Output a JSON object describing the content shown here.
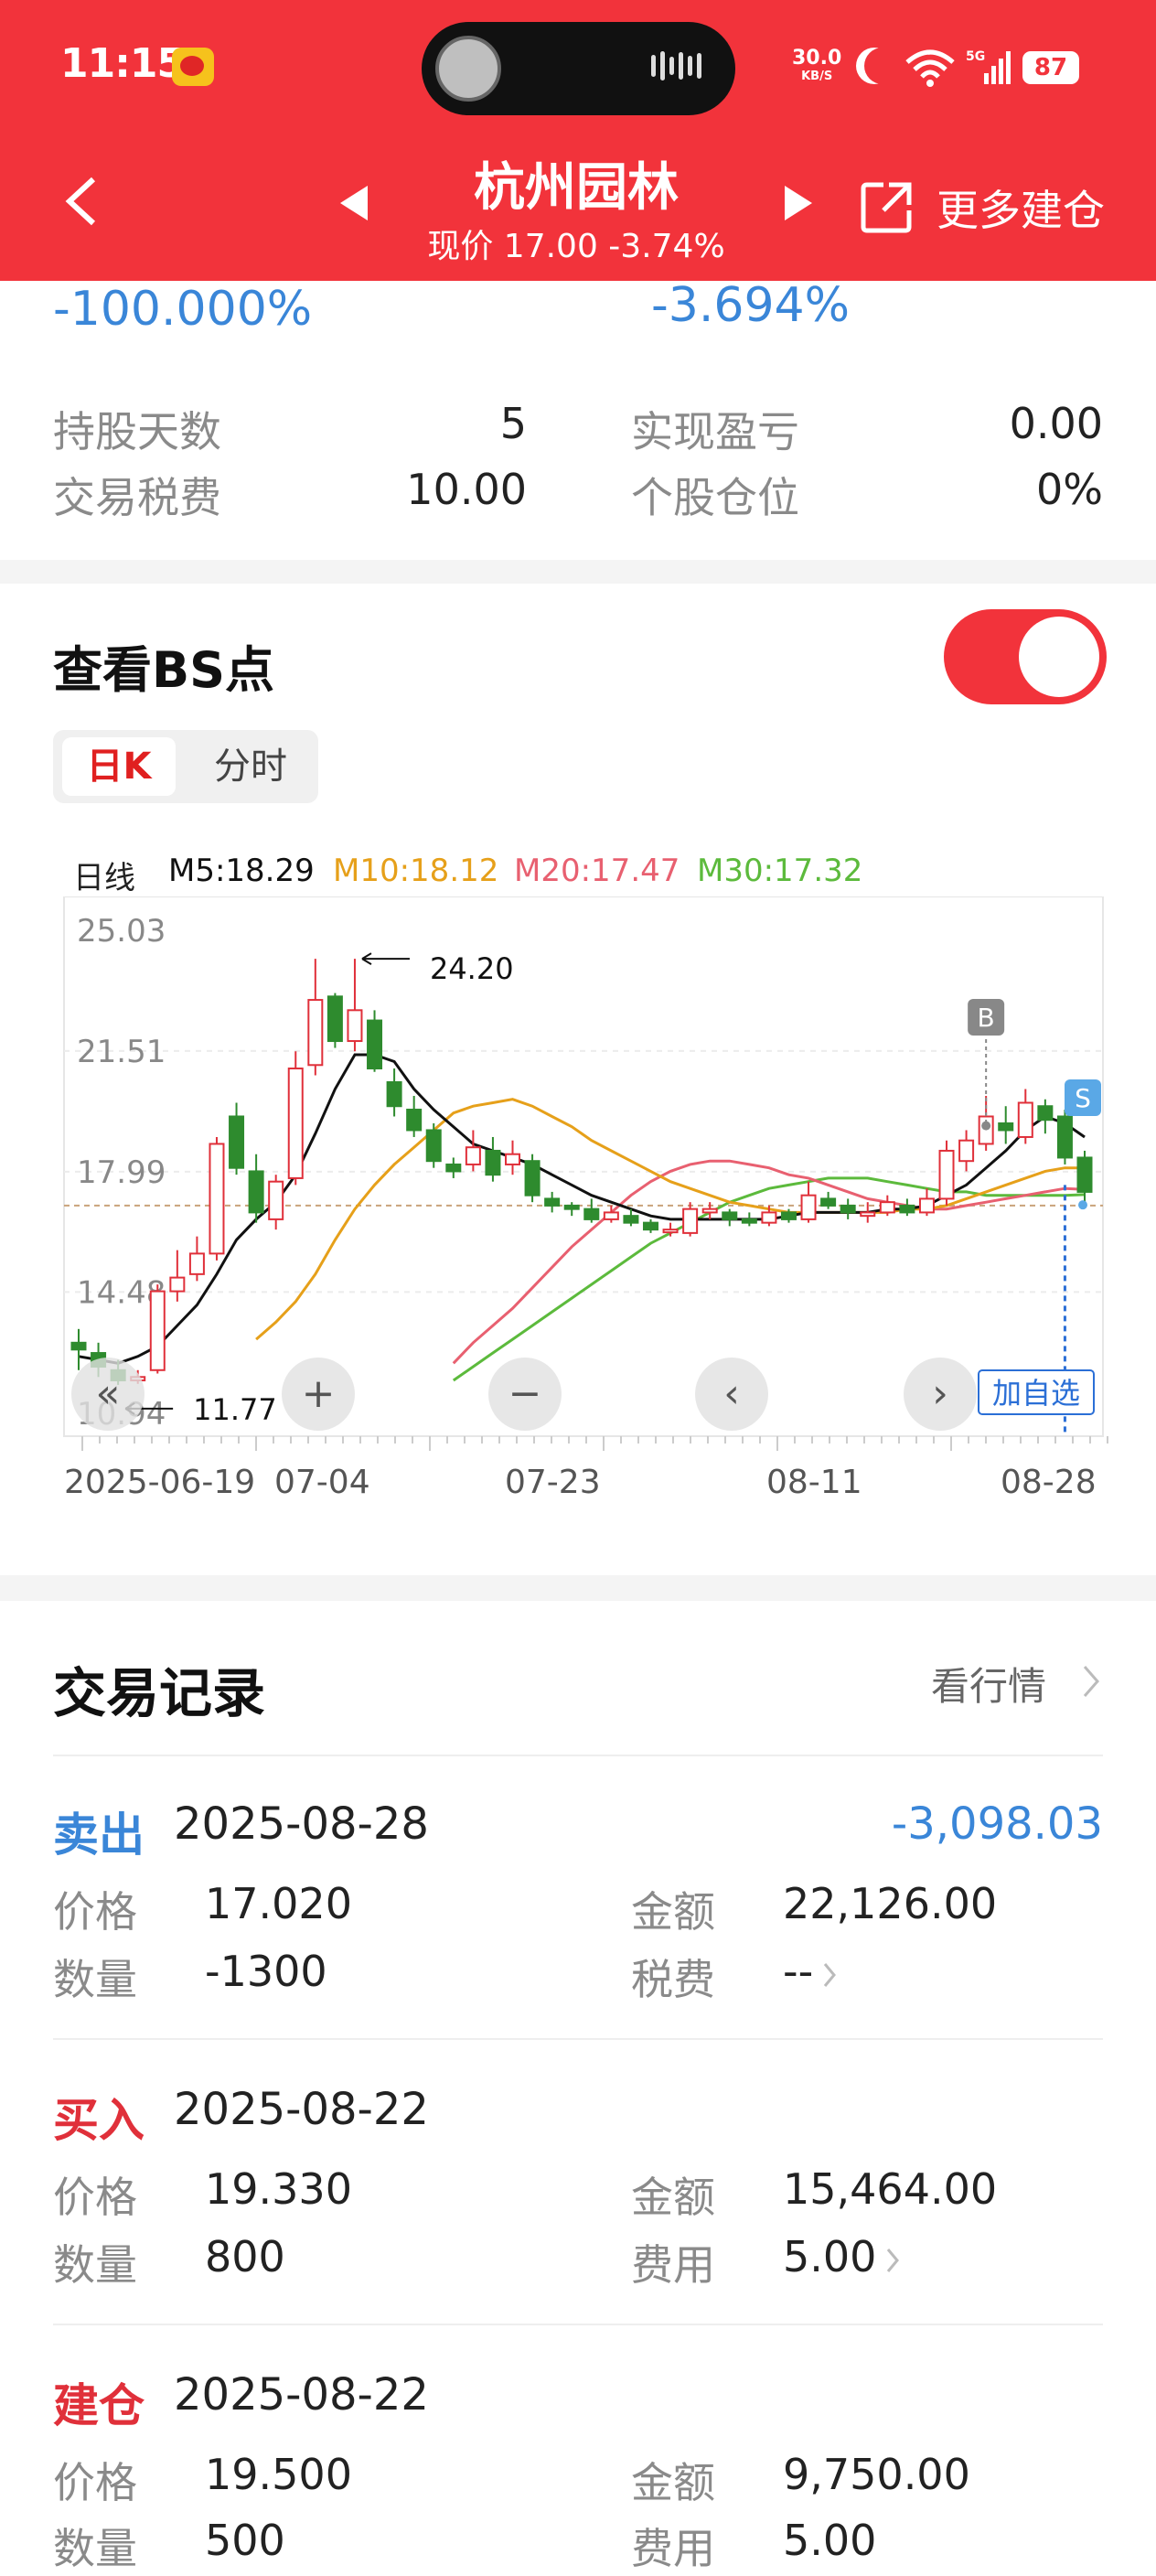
{
  "status_bar": {
    "time": "11:15",
    "net_speed": "30.0",
    "net_unit": "KB/S",
    "network": "5G",
    "battery": "87"
  },
  "header": {
    "stock_name": "杭州园林",
    "price_line": "现价 17.00 -3.74%",
    "more_label": "更多建仓"
  },
  "summary": {
    "pct_left": "-100.000%",
    "pct_right": "-3.694%",
    "hold_days_label": "持股天数",
    "hold_days_value": "5",
    "realized_pnl_label": "实现盈亏",
    "realized_pnl_value": "0.00",
    "tax_label": "交易税费",
    "tax_value": "10.00",
    "position_label": "个股仓位",
    "position_value": "0%"
  },
  "bs_section": {
    "title": "查看BS点",
    "toggle_on": true,
    "tab_daily": "日K",
    "tab_intraday": "分时"
  },
  "ma_legend": {
    "period": "日线",
    "m5": "M5:18.29",
    "m10": "M10:18.12",
    "m20": "M20:17.47",
    "m30": "M30:17.32"
  },
  "colors": {
    "accent": "#f2333b",
    "up": "#e0303a",
    "down": "#2e8b2e",
    "ma5": "#111111",
    "ma10": "#e6a01a",
    "ma20": "#e86070",
    "ma30": "#5cba3c",
    "blue": "#3a86d8"
  },
  "chart_controls": {
    "add_watch_label": "加自选",
    "buy_marker": "B",
    "sell_marker": "S"
  },
  "chart_data": {
    "type": "candlestick",
    "yticks": [
      "25.03",
      "21.51",
      "17.99",
      "14.48",
      "10.94"
    ],
    "ylim": [
      10.94,
      25.03
    ],
    "xticks": [
      "2025-06-19",
      "07-04",
      "07-23",
      "08-11",
      "08-28"
    ],
    "max_label": "24.20",
    "min_label": "11.77",
    "ref_price": 17.0,
    "candles": [
      [
        13.0,
        12.8,
        13.4,
        12.2
      ],
      [
        12.7,
        12.3,
        13.0,
        12.0
      ],
      [
        12.2,
        11.9,
        12.5,
        11.77
      ],
      [
        11.9,
        12.0,
        12.2,
        11.8
      ],
      [
        12.2,
        14.5,
        14.7,
        12.1
      ],
      [
        14.5,
        14.9,
        15.7,
        14.2
      ],
      [
        15.0,
        15.6,
        16.1,
        14.8
      ],
      [
        15.6,
        18.8,
        19.0,
        15.4
      ],
      [
        19.6,
        18.1,
        20.0,
        17.9
      ],
      [
        18.0,
        16.8,
        18.5,
        16.5
      ],
      [
        16.6,
        17.7,
        17.9,
        16.3
      ],
      [
        17.8,
        21.0,
        21.5,
        17.6
      ],
      [
        21.1,
        23.0,
        24.2,
        20.8
      ],
      [
        23.1,
        21.8,
        23.2,
        21.6
      ],
      [
        21.8,
        22.7,
        24.2,
        21.5
      ],
      [
        22.4,
        21.0,
        22.7,
        20.9
      ],
      [
        20.6,
        19.9,
        21.0,
        19.6
      ],
      [
        19.8,
        19.2,
        20.2,
        19.0
      ],
      [
        19.2,
        18.3,
        19.4,
        18.1
      ],
      [
        18.2,
        18.0,
        18.4,
        17.8
      ],
      [
        18.2,
        18.7,
        19.2,
        18.0
      ],
      [
        18.6,
        17.9,
        19.0,
        17.7
      ],
      [
        18.2,
        18.5,
        18.9,
        17.9
      ],
      [
        18.3,
        17.3,
        18.5,
        17.1
      ],
      [
        17.2,
        17.0,
        17.4,
        16.8
      ],
      [
        17.0,
        16.9,
        17.1,
        16.7
      ],
      [
        16.9,
        16.6,
        17.2,
        16.5
      ],
      [
        16.6,
        16.8,
        17.0,
        16.5
      ],
      [
        16.7,
        16.5,
        16.9,
        16.4
      ],
      [
        16.5,
        16.3,
        16.6,
        16.2
      ],
      [
        16.3,
        16.3,
        16.5,
        16.1
      ],
      [
        16.2,
        16.9,
        17.1,
        16.1
      ],
      [
        16.8,
        16.9,
        17.1,
        16.6
      ],
      [
        16.8,
        16.6,
        16.9,
        16.4
      ],
      [
        16.6,
        16.5,
        16.8,
        16.4
      ],
      [
        16.5,
        16.8,
        17.0,
        16.4
      ],
      [
        16.8,
        16.6,
        16.9,
        16.5
      ],
      [
        16.6,
        17.3,
        17.7,
        16.5
      ],
      [
        17.2,
        17.0,
        17.4,
        16.9
      ],
      [
        17.0,
        16.8,
        17.2,
        16.6
      ],
      [
        16.7,
        16.8,
        17.1,
        16.5
      ],
      [
        16.8,
        17.1,
        17.3,
        16.7
      ],
      [
        17.0,
        16.8,
        17.2,
        16.7
      ],
      [
        16.8,
        17.2,
        17.5,
        16.7
      ],
      [
        17.2,
        18.6,
        18.9,
        17.0
      ],
      [
        18.3,
        18.9,
        19.2,
        18.0
      ],
      [
        18.8,
        19.6,
        20.2,
        18.6
      ],
      [
        19.4,
        19.2,
        19.9,
        18.8
      ],
      [
        19.0,
        20.0,
        20.4,
        18.8
      ],
      [
        19.9,
        19.5,
        20.1,
        19.1
      ],
      [
        19.6,
        18.4,
        19.8,
        18.2
      ],
      [
        18.4,
        17.4,
        18.6,
        17.0
      ]
    ],
    "ma5": [
      12.6,
      12.5,
      12.4,
      12.6,
      12.9,
      13.5,
      14.1,
      15.0,
      16.0,
      16.6,
      17.1,
      17.9,
      19.1,
      20.4,
      21.4,
      21.4,
      21.2,
      20.4,
      19.8,
      19.3,
      18.8,
      18.6,
      18.4,
      18.2,
      17.9,
      17.6,
      17.3,
      17.1,
      16.9,
      16.7,
      16.6,
      16.6,
      16.6,
      16.6,
      16.6,
      16.6,
      16.7,
      16.8,
      16.8,
      16.8,
      16.8,
      16.9,
      16.9,
      17.0,
      17.3,
      17.6,
      18.1,
      18.6,
      19.2,
      19.6,
      19.4,
      19.0
    ],
    "ma10": [
      null,
      null,
      null,
      null,
      null,
      null,
      null,
      null,
      null,
      13.1,
      13.6,
      14.2,
      15.0,
      16.0,
      16.9,
      17.6,
      18.2,
      18.7,
      19.2,
      19.7,
      19.9,
      20.0,
      20.1,
      19.9,
      19.6,
      19.3,
      18.9,
      18.6,
      18.3,
      18.0,
      17.7,
      17.5,
      17.3,
      17.1,
      17.0,
      16.9,
      16.8,
      16.8,
      16.8,
      16.8,
      16.8,
      16.8,
      16.9,
      16.9,
      17.0,
      17.2,
      17.4,
      17.6,
      17.8,
      18.0,
      18.1,
      18.1
    ],
    "ma20": [
      null,
      null,
      null,
      null,
      null,
      null,
      null,
      null,
      null,
      null,
      null,
      null,
      null,
      null,
      null,
      null,
      null,
      null,
      null,
      12.4,
      13.0,
      13.5,
      14.0,
      14.6,
      15.2,
      15.8,
      16.3,
      16.8,
      17.3,
      17.7,
      18.0,
      18.2,
      18.3,
      18.3,
      18.2,
      18.1,
      17.9,
      17.8,
      17.6,
      17.4,
      17.2,
      17.1,
      17.0,
      16.9,
      16.9,
      17.0,
      17.1,
      17.2,
      17.3,
      17.4,
      17.5,
      17.47
    ],
    "ma30": [
      null,
      null,
      null,
      null,
      null,
      null,
      null,
      null,
      null,
      null,
      null,
      null,
      null,
      null,
      null,
      null,
      null,
      null,
      null,
      11.9,
      12.3,
      12.7,
      13.1,
      13.5,
      13.9,
      14.3,
      14.7,
      15.1,
      15.5,
      15.9,
      16.2,
      16.5,
      16.8,
      17.1,
      17.3,
      17.5,
      17.6,
      17.7,
      17.8,
      17.8,
      17.8,
      17.7,
      17.6,
      17.5,
      17.4,
      17.4,
      17.3,
      17.3,
      17.3,
      17.3,
      17.3,
      17.32
    ]
  },
  "records": {
    "title": "交易记录",
    "link": "看行情",
    "items": [
      {
        "type": "卖出",
        "date": "2025-08-28",
        "amount": "-3,098.03",
        "price_label": "价格",
        "price": "17.020",
        "total_label": "金额",
        "total": "22,126.00",
        "qty_label": "数量",
        "qty": "-1300",
        "fee_label": "税费",
        "fee": "--"
      },
      {
        "type": "买入",
        "date": "2025-08-22",
        "amount": "",
        "price_label": "价格",
        "price": "19.330",
        "total_label": "金额",
        "total": "15,464.00",
        "qty_label": "数量",
        "qty": "800",
        "fee_label": "费用",
        "fee": "5.00"
      },
      {
        "type": "建仓",
        "date": "2025-08-22",
        "amount": "",
        "price_label": "价格",
        "price": "19.500",
        "total_label": "金额",
        "total": "9,750.00",
        "qty_label": "数量",
        "qty": "500",
        "fee_label": "费用",
        "fee": "5.00"
      }
    ]
  }
}
